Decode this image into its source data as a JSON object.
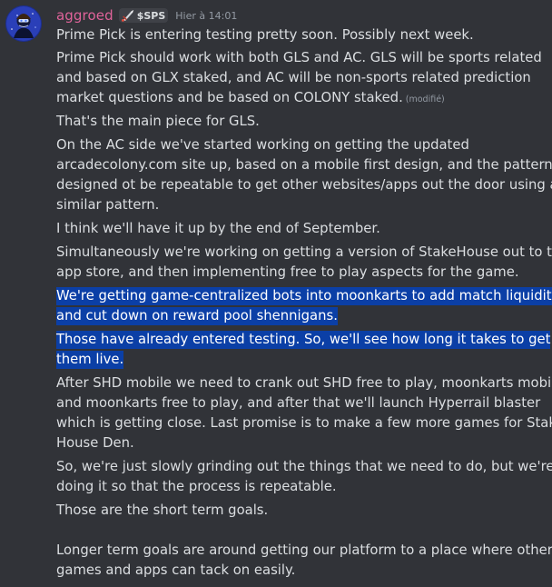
{
  "message": {
    "author": "aggroed",
    "tag": {
      "icon": "sword-icon",
      "label": "$SPS"
    },
    "timestamp": "Hier à 14:01",
    "edited_label": "(modifié)",
    "lines": [
      "Prime Pick is entering testing pretty soon.  Possibly next week.",
      "Prime Pick should work with both GLS and AC.  GLS will be sports related",
      "and based on GLX staked, and AC will be non-sports related prediction",
      "market questions and be based on COLONY staked.",
      "That's the main piece for GLS.",
      "On the AC side we've started working on getting the updated",
      "arcadecolony.com site up, based on a mobile first design, and the pattern is",
      "designed ot be repeatable to get other websites/apps out the door using a",
      "similar pattern.",
      "I think we'll have it up by the end of September.",
      "Simultaneously we're working on getting a version of StakeHouse out to the",
      "app store, and then implementing free to play aspects for the game.",
      "We're getting game-centralized bots into moonkarts to add match liquidity",
      "and cut down on reward pool shennigans.",
      "Those have already entered testing.  So, we'll see how long it takes to get",
      "them live.",
      "After SHD mobile we need to crank out SHD free to play, moonkarts mobile,",
      "and moonkarts free to play, and after that we'll launch Hyperrail blaster",
      "which is getting close.  Last promise is to make a few more games for Stake",
      "House Den.",
      "So, we're just slowly grinding out the things that we need to do, but we're",
      "doing it so that the process is repeatable.",
      "Those are the short term goals.",
      "Longer term goals are around getting our platform to a place where other",
      "games and apps can tack on easily."
    ]
  },
  "colors": {
    "background": "#313338",
    "username": "#e0639a",
    "text": "#dbdee1",
    "muted": "#949ba4",
    "selection": "#0b3fa6"
  }
}
